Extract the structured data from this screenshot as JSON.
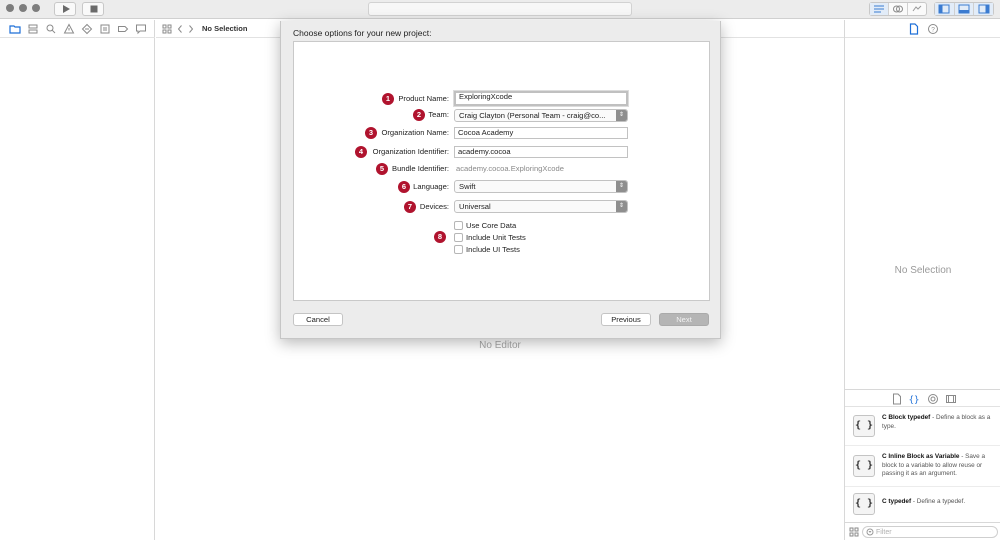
{
  "window": {
    "traffic_lights": [
      "close",
      "minimize",
      "zoom"
    ],
    "toolbar_icons": [
      "play-icon",
      "stop-icon"
    ]
  },
  "navigator": {
    "icons": [
      "folder-icon",
      "source-control-icon",
      "search-icon",
      "warning-icon",
      "test-icon",
      "debug-icon",
      "breakpoint-icon",
      "report-icon"
    ]
  },
  "jumpbar": {
    "label": "No Selection"
  },
  "editor": {
    "placeholder": "No Editor"
  },
  "inspector": {
    "placeholder": "No Selection",
    "library_items": [
      {
        "title": "C Block typedef",
        "description": " - Define a block as a type.",
        "glyph": "{ }"
      },
      {
        "title": "C Inline Block as Variable",
        "description": " - Save a block to a variable to allow reuse or passing it as an argument.",
        "glyph": "{ }"
      },
      {
        "title": "C typedef",
        "description": " - Define a typedef.",
        "glyph": "{ }"
      }
    ],
    "filter_placeholder": "Filter"
  },
  "dialog": {
    "title": "Choose options for your new project:",
    "fields": {
      "product_name": {
        "badge": "1",
        "label": "Product Name:",
        "value": "ExploringXcode"
      },
      "team": {
        "badge": "2",
        "label": "Team:",
        "value": "Craig Clayton (Personal Team - craig@co..."
      },
      "organization_name": {
        "badge": "3",
        "label": "Organization Name:",
        "value": "Cocoa Academy"
      },
      "organization_identifier": {
        "badge": "4",
        "label": "Organization Identifier:",
        "value": "academy.cocoa"
      },
      "bundle_identifier": {
        "badge": "5",
        "label": "Bundle Identifier:",
        "value": "academy.cocoa.ExploringXcode"
      },
      "language": {
        "badge": "6",
        "label": "Language:",
        "value": "Swift"
      },
      "devices": {
        "badge": "7",
        "label": "Devices:",
        "value": "Universal"
      }
    },
    "options_badge": "8",
    "options": [
      {
        "label": "Use Core Data",
        "checked": false
      },
      {
        "label": "Include Unit Tests",
        "checked": false
      },
      {
        "label": "Include UI Tests",
        "checked": false
      }
    ],
    "buttons": {
      "cancel": "Cancel",
      "previous": "Previous",
      "next": "Next"
    }
  },
  "colors": {
    "badge": "#b0132e",
    "accent": "#1d6fd8",
    "disabled_button": "#b5b5b5"
  }
}
